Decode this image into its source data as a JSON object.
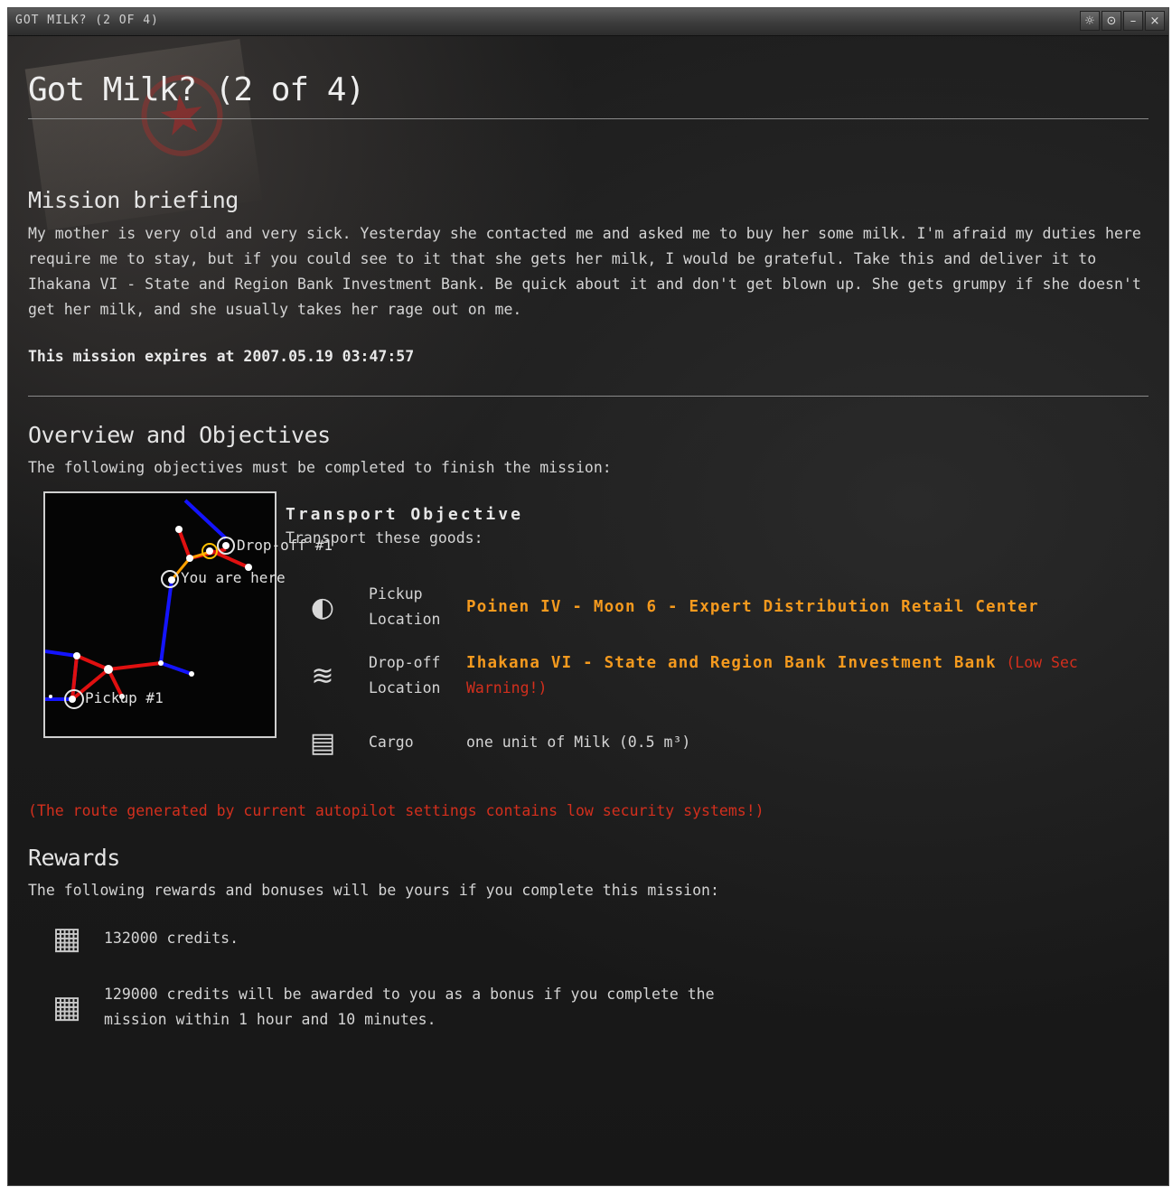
{
  "window": {
    "title": "GOT MILK? (2 OF 4)",
    "buttons": {
      "settings": "☼",
      "info": "⊙",
      "minimize": "–",
      "close": "×"
    }
  },
  "mission": {
    "title": "Got Milk? (2 of 4)",
    "briefing_heading": "Mission briefing",
    "briefing_text": "My mother is very old and very sick. Yesterday she contacted me and asked me to buy her some milk. I'm afraid my duties here require me to stay, but if you could see to it that she gets her milk, I would be grateful. Take this and deliver it to Ihakana VI - State and Region Bank Investment Bank. Be quick about it and don't get blown up. She gets grumpy if she doesn't get her milk, and she usually takes her rage out on me.",
    "expires": "This mission expires at 2007.05.19 03:47:57"
  },
  "overview": {
    "heading": "Overview and Objectives",
    "intro": "The following objectives must be completed to finish the mission:",
    "map_labels": {
      "dropoff": "Drop-off #1",
      "here": "You are here",
      "pickup": "Pickup #1"
    },
    "objective_title": "Transport Objective",
    "objective_sub": "Transport these goods:",
    "pickup_label": "Pickup Location",
    "pickup_value": "Poinen IV - Moon 6 - Expert Distribution Retail Center",
    "dropoff_label": "Drop-off Location",
    "dropoff_value": "Ihakana VI - State and Region Bank Investment Bank",
    "dropoff_warning": "(Low Sec Warning!)",
    "cargo_label": "Cargo",
    "cargo_value": "one unit of Milk (0.5 m³)",
    "route_warning": "(The route generated by current autopilot settings contains low security systems!)"
  },
  "rewards": {
    "heading": "Rewards",
    "intro": "The following rewards and bonuses will be yours if you complete this mission:",
    "reward": "132000 credits.",
    "bonus": "129000 credits will be awarded to you as a bonus if you complete the mission within 1 hour and 10 minutes."
  },
  "colors": {
    "accent_orange": "#f59a1e",
    "warning_red": "#d32f1d",
    "route_blue": "#1414ff",
    "route_red": "#e01010"
  },
  "icons": {
    "pickup": "corporation-logo-icon",
    "dropoff": "bank-logo-icon",
    "cargo": "milk-carton-icon",
    "reward": "isk-credits-icon"
  }
}
